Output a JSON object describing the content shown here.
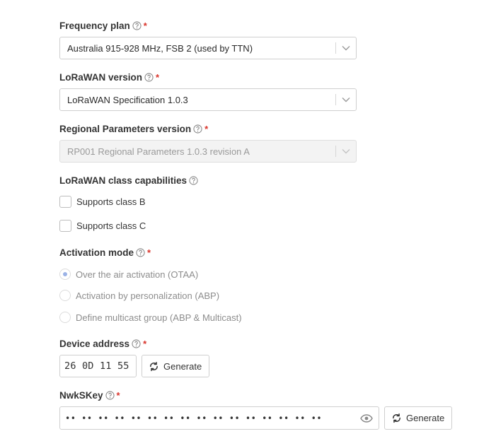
{
  "frequency_plan": {
    "label": "Frequency plan",
    "required_mark": "*",
    "value": "Australia 915-928 MHz, FSB 2 (used by TTN)"
  },
  "lorawan_version": {
    "label": "LoRaWAN version",
    "required_mark": "*",
    "value": "LoRaWAN Specification 1.0.3"
  },
  "regional_parameters": {
    "label": "Regional Parameters version",
    "required_mark": "*",
    "value": "RP001 Regional Parameters 1.0.3 revision A",
    "disabled": true
  },
  "class_capabilities": {
    "label": "LoRaWAN class capabilities",
    "options": [
      {
        "label": "Supports class B",
        "checked": false
      },
      {
        "label": "Supports class C",
        "checked": false
      }
    ]
  },
  "activation_mode": {
    "label": "Activation mode",
    "required_mark": "*",
    "options": [
      {
        "label": "Over the air activation (OTAA)",
        "selected": true
      },
      {
        "label": "Activation by personalization (ABP)",
        "selected": false
      },
      {
        "label": "Define multicast group (ABP & Multicast)",
        "selected": false
      }
    ]
  },
  "device_address": {
    "label": "Device address",
    "required_mark": "*",
    "value": "26 0D 11 55",
    "generate_label": "Generate"
  },
  "nwkskey": {
    "label": "NwkSKey",
    "required_mark": "*",
    "masked_value": "•• •• •• •• •• •• •• •• •• •• •• •• •• •• •• ••",
    "generate_label": "Generate"
  },
  "colors": {
    "required": "#d9342b",
    "radio_selected": "#9bb2e6",
    "border": "#cfcfcf",
    "disabled_bg": "#f3f3f3"
  }
}
